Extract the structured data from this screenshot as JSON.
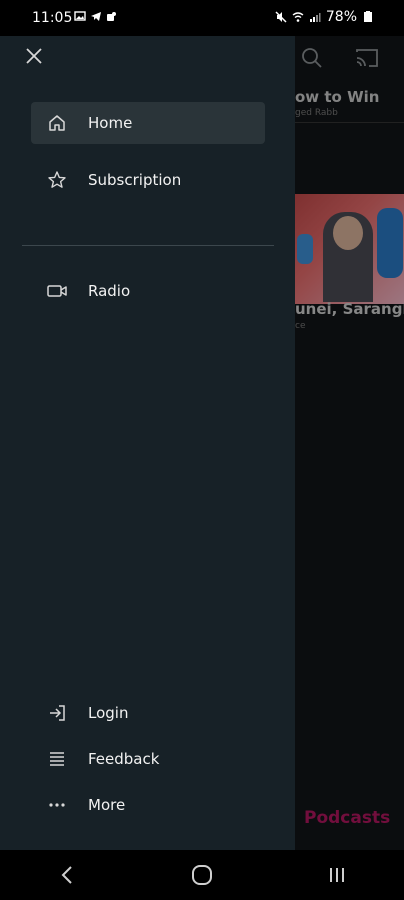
{
  "status_bar": {
    "time": "11:05",
    "battery": "78%",
    "left_icons": [
      "gallery-icon",
      "telegram-icon",
      "teams-icon"
    ],
    "right_icons": [
      "mute-icon",
      "wifi-icon",
      "signal-icon",
      "battery-icon"
    ]
  },
  "background": {
    "headline": "ow to Win",
    "headline_sub": "ged Rabb",
    "card_title": "unei, Sarangh",
    "card_sub": "ce",
    "bottom_label": "Podcasts",
    "accent_color": "#b0165e"
  },
  "drawer": {
    "close_icon": "close-icon",
    "primary_items": [
      {
        "label": "Home",
        "icon": "home-icon",
        "active": true
      },
      {
        "label": "Subscription",
        "icon": "star-icon",
        "active": false
      }
    ],
    "secondary_items": [
      {
        "label": "Radio",
        "icon": "video-icon"
      }
    ],
    "bottom_items": [
      {
        "label": "Login",
        "icon": "login-icon"
      },
      {
        "label": "Feedback",
        "icon": "list-icon"
      },
      {
        "label": "More",
        "icon": "more-icon"
      }
    ],
    "colors": {
      "background": "#172127",
      "active": "#2a3439"
    }
  },
  "nav_bar": {
    "buttons": [
      "back-icon",
      "home-circle-icon",
      "recents-icon"
    ]
  }
}
